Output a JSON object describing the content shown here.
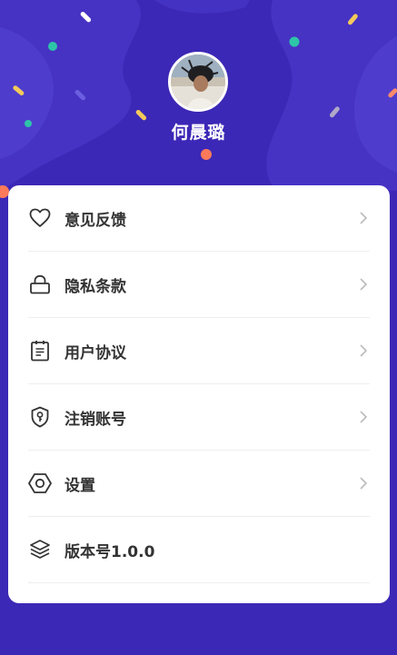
{
  "profile": {
    "username": "何晨璐"
  },
  "menu": {
    "items": [
      {
        "label": "意见反馈",
        "icon": "heart-icon",
        "has_chevron": true
      },
      {
        "label": "隐私条款",
        "icon": "lock-icon",
        "has_chevron": true
      },
      {
        "label": "用户协议",
        "icon": "clipboard-icon",
        "has_chevron": true
      },
      {
        "label": "注销账号",
        "icon": "shield-key-icon",
        "has_chevron": true
      },
      {
        "label": "设置",
        "icon": "hexagon-settings-icon",
        "has_chevron": true
      },
      {
        "label": "版本号1.0.0",
        "icon": "layers-icon",
        "has_chevron": false
      }
    ]
  },
  "colors": {
    "background": "#3c28b6",
    "card": "#ffffff",
    "text": "#333333",
    "chevron": "#bbbbbb"
  }
}
